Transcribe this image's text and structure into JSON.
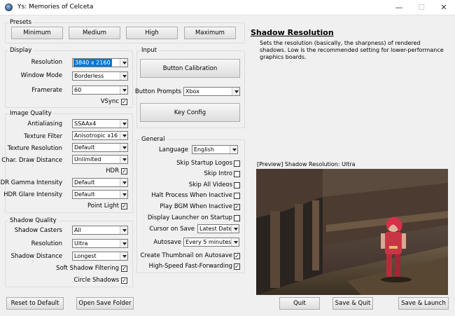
{
  "window": {
    "title": "Ys: Memories of Celceta"
  },
  "presets": {
    "label": "Presets",
    "buttons": [
      "Minimum",
      "Medium",
      "High",
      "Maximum"
    ]
  },
  "display": {
    "label": "Display",
    "resolution": {
      "label": "Resolution",
      "value": "3840 x 2160"
    },
    "window_mode": {
      "label": "Window Mode",
      "value": "Borderless"
    },
    "framerate": {
      "label": "Framerate",
      "value": "60"
    },
    "vsync": {
      "label": "VSync",
      "checked": true
    }
  },
  "image_quality": {
    "label": "Image Quality",
    "antialiasing": {
      "label": "Antialiasing",
      "value": "SSAAx4"
    },
    "texture_filter": {
      "label": "Texture Filter",
      "value": "Anisotropic x16"
    },
    "texture_resolution": {
      "label": "Texture Resolution",
      "value": "Default"
    },
    "char_draw_distance": {
      "label": "Char. Draw Distance",
      "value": "Unlimited"
    },
    "hdr": {
      "label": "HDR",
      "checked": true
    },
    "hdr_gamma": {
      "label": "HDR Gamma Intensity",
      "value": "Default"
    },
    "hdr_glare": {
      "label": "HDR Glare Intensity",
      "value": "Default"
    },
    "point_light": {
      "label": "Point Light",
      "checked": true
    }
  },
  "shadow_quality": {
    "label": "Shadow Quality",
    "shadow_casters": {
      "label": "Shadow Casters",
      "value": "All"
    },
    "resolution": {
      "label": "Resolution",
      "value": "Ultra"
    },
    "shadow_distance": {
      "label": "Shadow Distance",
      "value": "Longest"
    },
    "soft_shadow": {
      "label": "Soft Shadow Filtering",
      "checked": true
    },
    "circle_shadows": {
      "label": "Circle Shadows",
      "checked": true
    }
  },
  "input": {
    "label": "Input",
    "button_calibration": "Button Calibration",
    "button_prompts": {
      "label": "Button Prompts",
      "value": "Xbox"
    },
    "key_config": "Key Config"
  },
  "general": {
    "label": "General",
    "language": {
      "label": "Language",
      "value": "English"
    },
    "skip_startup_logos": {
      "label": "Skip Startup Logos",
      "checked": false
    },
    "skip_intro": {
      "label": "Skip Intro",
      "checked": false
    },
    "skip_all_videos": {
      "label": "Skip All Videos",
      "checked": false
    },
    "halt_process": {
      "label": "Halt Process When Inactive",
      "checked": false
    },
    "play_bgm": {
      "label": "Play BGM When Inactive",
      "checked": true
    },
    "display_launcher": {
      "label": "Display Launcher on Startup",
      "checked": false
    },
    "cursor_on_save": {
      "label": "Cursor on Save",
      "value": "Latest Date"
    },
    "autosave": {
      "label": "Autosave",
      "value": "Every 5 minutes"
    },
    "create_thumbnail": {
      "label": "Create Thumbnail on Autosave",
      "checked": true
    },
    "high_speed_ff": {
      "label": "High-Speed Fast-Forwarding",
      "checked": true
    }
  },
  "help": {
    "title": "Shadow Resolution",
    "description": "Sets the resolution (basically, the sharpness) of rendered shadows. Low is the recommended setting for lower-performance graphics boards.",
    "preview_label": "[Preview]  Shadow Resolution: Ultra"
  },
  "footer": {
    "reset": "Reset to Default",
    "open_save": "Open Save Folder",
    "quit": "Quit",
    "save_quit": "Save & Quit",
    "save_launch": "Save & Launch"
  },
  "icons": {
    "app": "app-orb-icon",
    "minimize": "minimize-icon",
    "maximize": "maximize-icon",
    "close": "close-icon"
  }
}
